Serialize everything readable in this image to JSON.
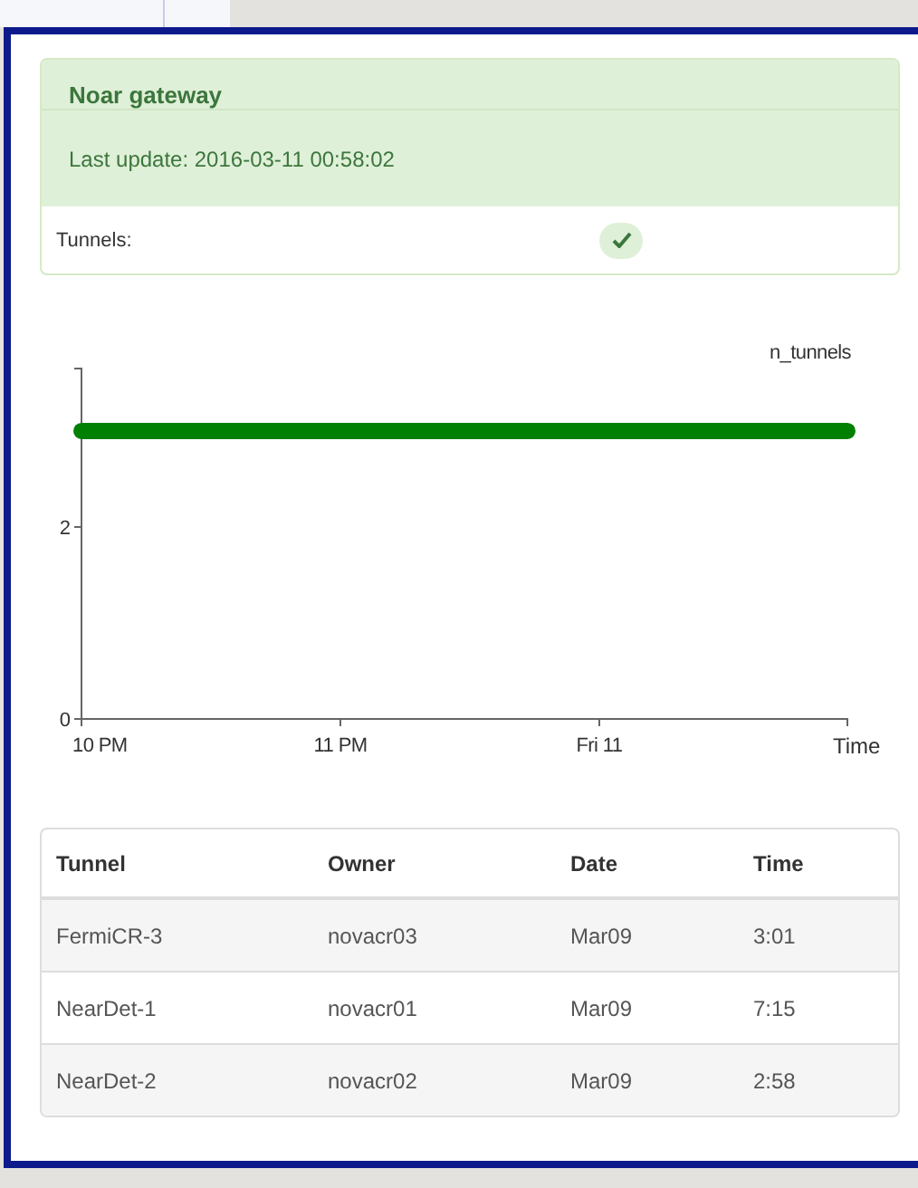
{
  "panel": {
    "title": "Noar gateway",
    "last_update": "Last update: 2016-03-11 00:58:02",
    "status_label": "Tunnels:",
    "tunnels_ok": true
  },
  "chart": {
    "chart_data": {
      "type": "line",
      "xlabel": "Time",
      "categories": [
        "10 PM",
        "11 PM",
        "Fri 11",
        null
      ],
      "series": [
        {
          "name": "n_tunnels",
          "color": "#008000",
          "values": [
            3,
            3,
            3,
            3
          ]
        }
      ],
      "ylim": [
        0,
        3.66
      ],
      "yticks": [
        0,
        2
      ]
    }
  },
  "table": {
    "columns": [
      "Tunnel",
      "Owner",
      "Date",
      "Time"
    ],
    "rows": [
      [
        "FermiCR-3",
        "novacr03",
        "Mar09",
        "3:01"
      ],
      [
        "NearDet-1",
        "novacr01",
        "Mar09",
        "7:15"
      ],
      [
        "NearDet-2",
        "novacr02",
        "Mar09",
        "2:58"
      ]
    ]
  }
}
